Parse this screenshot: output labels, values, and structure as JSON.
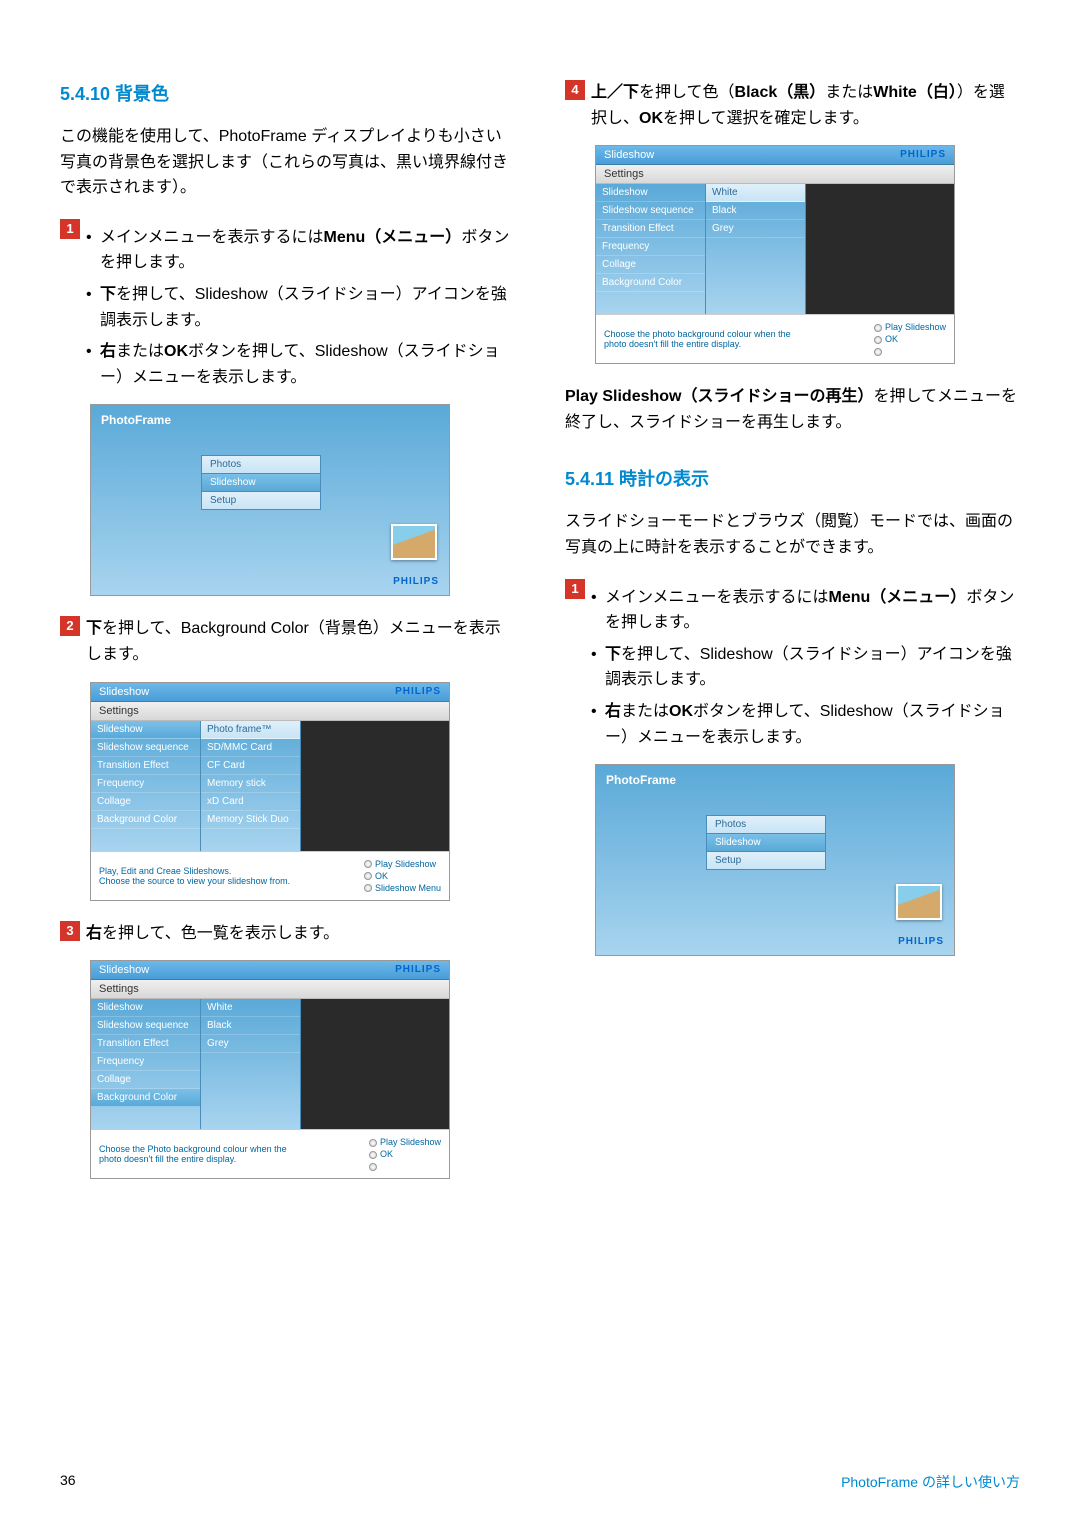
{
  "sections": {
    "s5410": {
      "title": "5.4.10  背景色",
      "intro": "この機能を使用して、PhotoFrame ディスプレイよりも小さい写真の背景色を選択します（これらの写真は、黒い境界線付きで表示されます）。"
    },
    "s5411": {
      "title": "5.4.11  時計の表示",
      "intro": "スライドショーモードとブラウズ（閲覧）モードでは、画面の写真の上に時計を表示することができます。"
    }
  },
  "steps": {
    "n1": "1",
    "n2": "2",
    "n3": "3",
    "n4": "4",
    "s1a_pre": "メインメニューを表示するには",
    "s1a_menu": "Menu（メニュー）",
    "s1a_post": "ボタンを押します。",
    "s1b_pre": "下",
    "s1b_post": "を押して、Slideshow（スライドショー）アイコンを強調表示します。",
    "s1c_pre": "右",
    "s1c_mid": "または",
    "s1c_ok": "OK",
    "s1c_post": "ボタンを押して、Slideshow（スライドショー）メニューを表示します。",
    "s2": "を押して、Background Color（背景色）メニューを表示します。",
    "s2_pre": "下",
    "s3": "を押して、色一覧を表示します。",
    "s3_pre": "右",
    "s4_pre": "上／下",
    "s4_mid1": "を押して色（",
    "s4_black": "Black（黒）",
    "s4_mid2": "または",
    "s4_white": "White（白）",
    "s4_mid3": "）を選択し、",
    "s4_ok": "OK",
    "s4_post": "を押して選択を確定します。",
    "play_pre": "Play Slideshow（スライドショーの再生）",
    "play_post": "を押してメニューを終了し、スライドショーを再生します。"
  },
  "shot": {
    "slideshow": "Slideshow",
    "settings": "Settings",
    "photoframe": "PhotoFrame",
    "philips": "PHILIPS",
    "left": [
      "Slideshow",
      "Slideshow sequence",
      "Transition Effect",
      "Frequency",
      "Collage",
      "Background Color"
    ],
    "mid_sources": [
      "Photo frame™",
      "SD/MMC Card",
      "CF Card",
      "Memory stick",
      "xD Card",
      "Memory Stick Duo"
    ],
    "mid_colors": [
      "White",
      "Black",
      "Grey"
    ],
    "center": [
      "Photos",
      "Slideshow",
      "Setup"
    ],
    "foot1": "Play, Edit and Creae Slideshows.",
    "foot1b": "Choose the source to view your slideshow from.",
    "foot2": "Choose the Photo background colour when the",
    "foot2b": "photo doesn't fill the entire display.",
    "foot3": "Choose the photo background colour when the",
    "foot3b": "photo doesn't fill the entire display.",
    "play": "Play Slideshow",
    "ok": "OK",
    "slmenu": "Slideshow Menu"
  },
  "footer": {
    "page": "36",
    "right": "PhotoFrame の詳しい使い方"
  }
}
